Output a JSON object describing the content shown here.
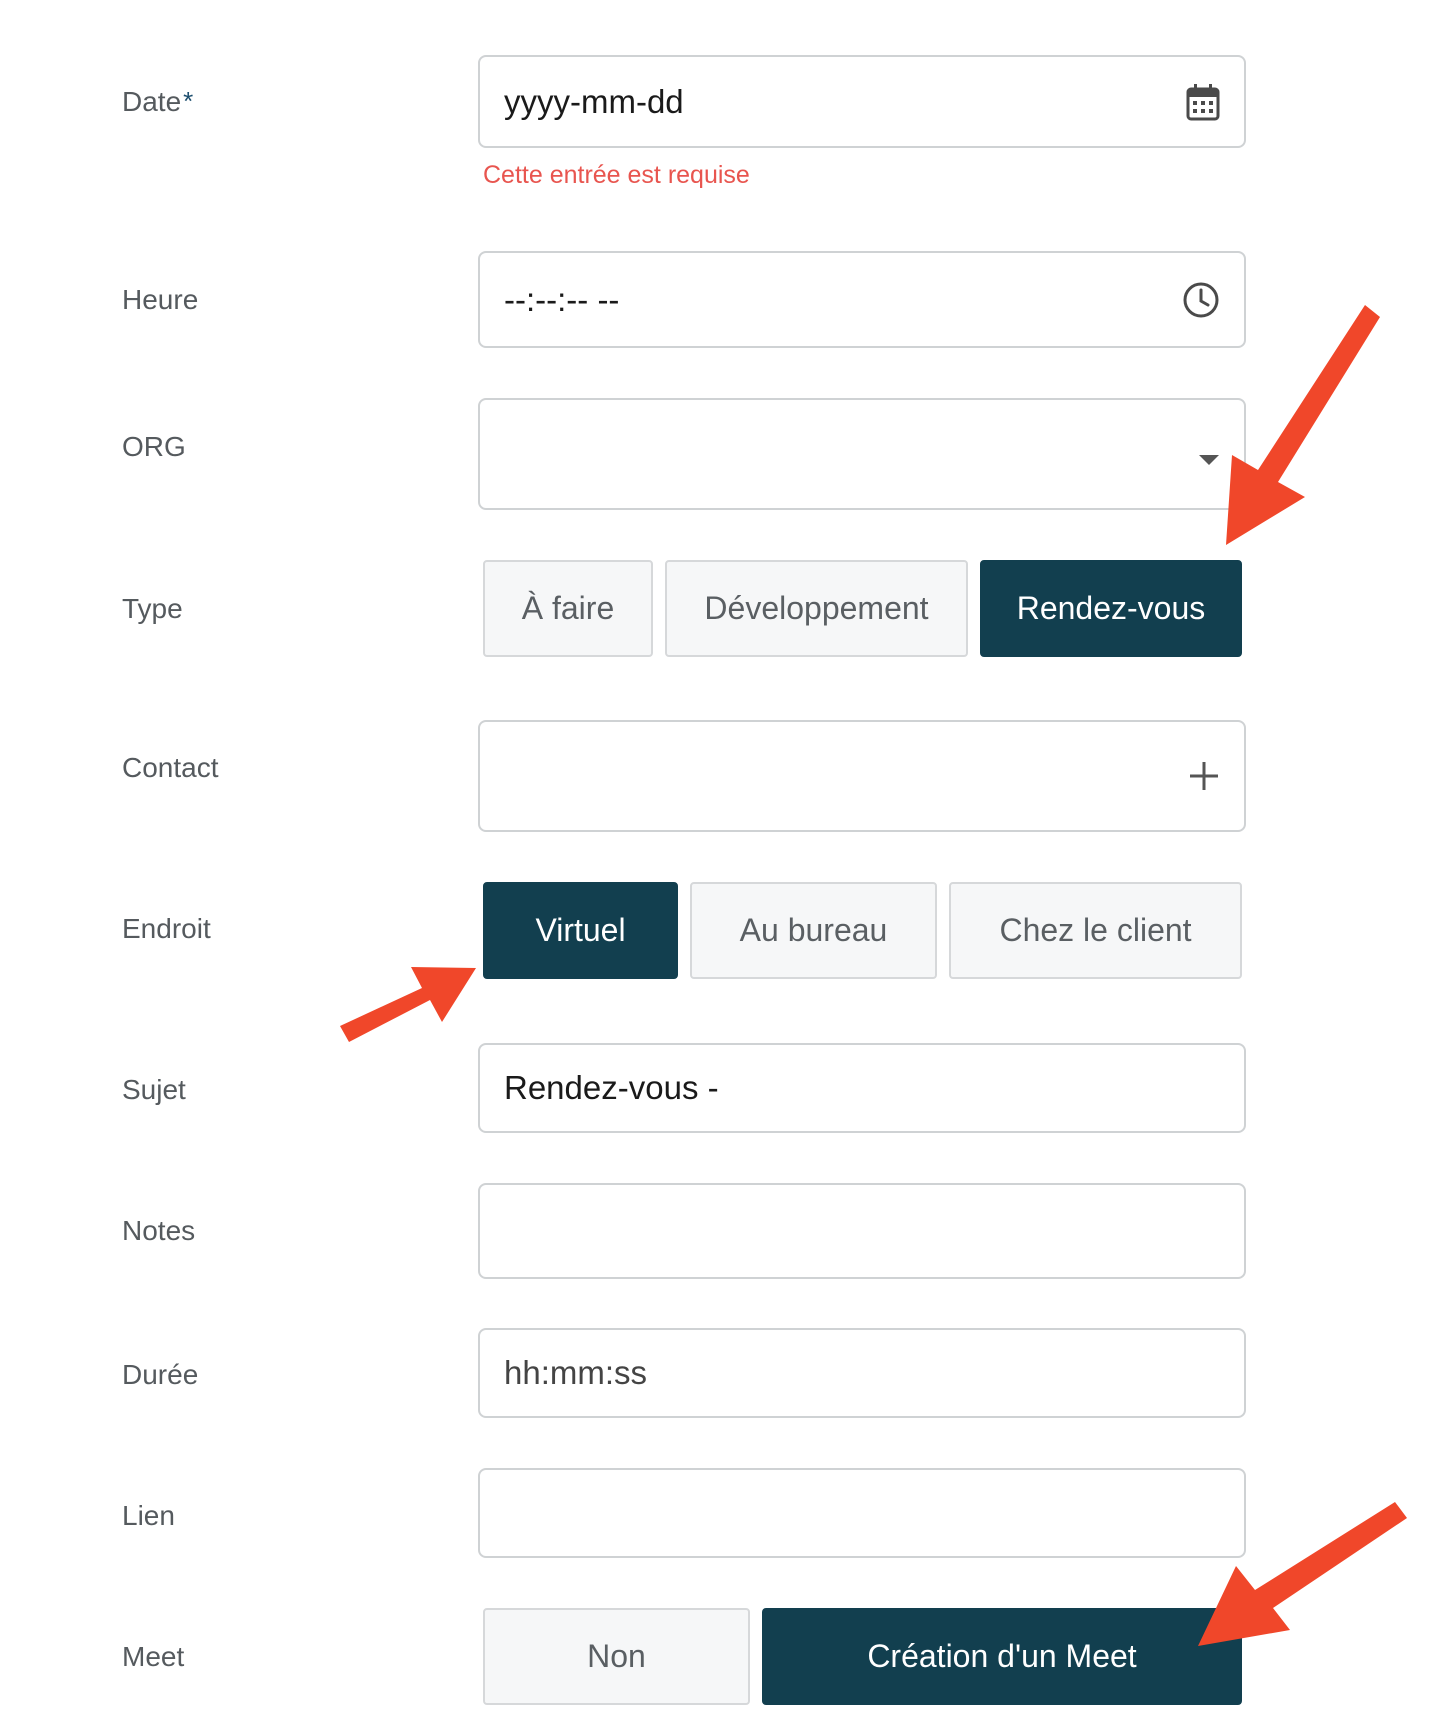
{
  "form": {
    "date": {
      "label": "Date",
      "required_mark": "*",
      "placeholder": "yyyy-mm-dd",
      "error": "Cette entrée est requise",
      "icon": "calendar-icon"
    },
    "time": {
      "label": "Heure",
      "placeholder": "--:--:-- --",
      "icon": "clock-icon"
    },
    "org": {
      "label": "ORG",
      "value": "",
      "icon": "caret-down-icon"
    },
    "type": {
      "label": "Type",
      "options": [
        "À faire",
        "Développement",
        "Rendez-vous"
      ],
      "selected": "Rendez-vous"
    },
    "contact": {
      "label": "Contact",
      "value": "",
      "icon": "plus-icon"
    },
    "location": {
      "label": "Endroit",
      "options": [
        "Virtuel",
        "Au bureau",
        "Chez le client"
      ],
      "selected": "Virtuel"
    },
    "subject": {
      "label": "Sujet",
      "value": "Rendez-vous -"
    },
    "notes": {
      "label": "Notes",
      "value": ""
    },
    "duration": {
      "label": "Durée",
      "placeholder": "hh:mm:ss"
    },
    "link": {
      "label": "Lien",
      "value": ""
    },
    "meet": {
      "label": "Meet",
      "options": [
        "Non",
        "Création d'un Meet"
      ],
      "selected": "Création d'un Meet"
    }
  },
  "colors": {
    "active": "#123f4f",
    "error": "#e8554f",
    "arrow": "#f0472a"
  }
}
